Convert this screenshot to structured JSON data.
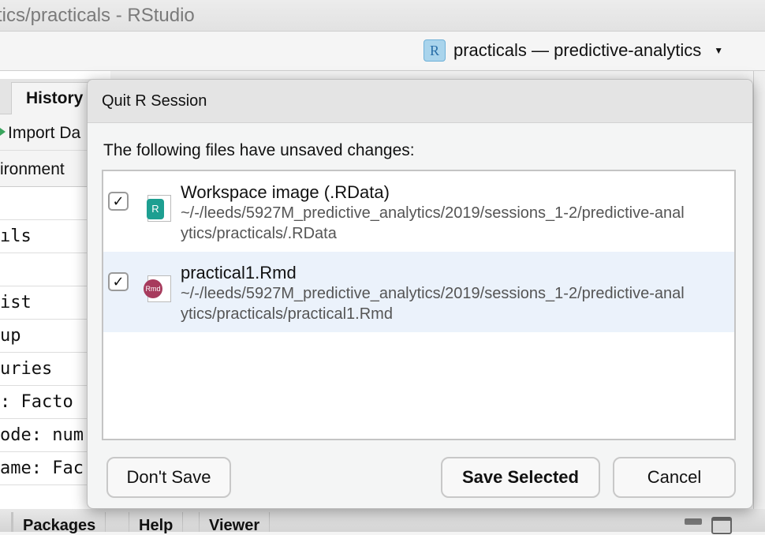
{
  "window": {
    "title": "tics/practicals - RStudio"
  },
  "toolbar": {
    "project_label": "practicals — predictive-analytics",
    "project_icon": "r-project-cube-icon"
  },
  "left_pane": {
    "tab": "History",
    "import_label": "Import Da",
    "env_label": "ironment",
    "rows": [
      "",
      "ıls",
      "",
      "ist",
      "up",
      "uries",
      " : Facto",
      "ode: num",
      "ame: Fac",
      ""
    ]
  },
  "bottom_tabs": [
    "Packages",
    "Help",
    "Viewer"
  ],
  "dialog": {
    "title": "Quit R Session",
    "message": "The following files have unsaved changes:",
    "files": [
      {
        "name": "Workspace image (.RData)",
        "path": "~/-/leeds/5927M_predictive_analytics/2019/sessions_1-2/predictive-analytics/practicals/.RData",
        "checked": true,
        "icon": "rdata-file-icon",
        "icon_text": "R",
        "selected": false
      },
      {
        "name": "practical1.Rmd",
        "path": "~/-/leeds/5927M_predictive_analytics/2019/sessions_1-2/predictive-analytics/practicals/practical1.Rmd",
        "checked": true,
        "icon": "rmd-file-icon",
        "icon_text": "Rmd",
        "selected": true
      }
    ],
    "buttons": {
      "dont_save": "Don't Save",
      "save_selected": "Save Selected",
      "cancel": "Cancel"
    }
  },
  "colors": {
    "selected_row": "#ebf2fb",
    "rdata_icon": "#1d9f91",
    "rmd_icon": "#a73b5d"
  }
}
